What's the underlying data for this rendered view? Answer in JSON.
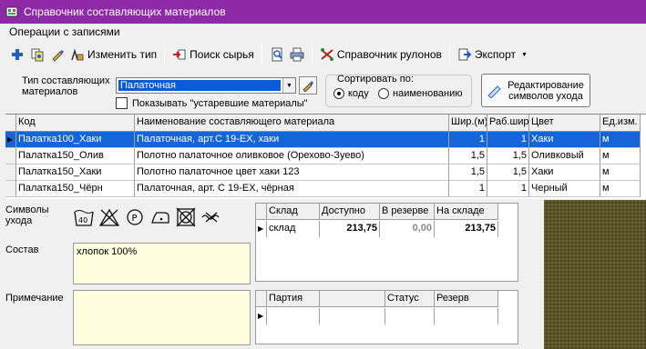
{
  "window": {
    "title": "Справочник составляющих материалов"
  },
  "menu": {
    "item": "Операции с записями"
  },
  "toolbar": {
    "change_type": "Изменить тип",
    "find_raw": "Поиск сырья",
    "rolls_ref": "Справочник рулонов",
    "export": "Экспорт"
  },
  "filter": {
    "type_label_1": "Тип составляющих",
    "type_label_2": "материалов",
    "type_value": "Палаточная",
    "show_outdated": "Показывать \"устаревшие материалы\"",
    "sort_label": "Сортировать по:",
    "sort_code": "коду",
    "sort_name": "наименованию",
    "edit_btn_1": "Редактирование",
    "edit_btn_2": "символов ухода"
  },
  "grid": {
    "headers": [
      "Код",
      "Наименование составляющего материала",
      "Шир.(м)",
      "Раб.шир",
      "Цвет",
      "Ед.изм."
    ],
    "rows": [
      [
        "Палатка100_Хаки",
        "Палаточная, арт.С 19-ЕХ, хаки",
        "1",
        "1",
        "Хаки",
        "м"
      ],
      [
        "Палатка150_Олив",
        "Полотно палаточное оливковое (Орехово-Зуево)",
        "1,5",
        "1,5",
        "Оливковый",
        "м"
      ],
      [
        "Палатка150_Хаки",
        "Полотно палаточное цвет хаки 123",
        "1,5",
        "1,5",
        "Хаки",
        "м"
      ],
      [
        "Палатка150_Чёрн",
        "Палаточная, арт. С 19-ЕХ, чёрная",
        "1",
        "1",
        "Черный",
        "м"
      ]
    ]
  },
  "details": {
    "care_label_1": "Символы",
    "care_label_2": "ухода",
    "composition_label": "Состав",
    "composition_value": "хлопок 100%",
    "note_label": "Примечание"
  },
  "stock": {
    "headers": [
      "Склад",
      "Доступно",
      "В резерве",
      "На складе"
    ],
    "row": [
      "склад",
      "213,75",
      "0,00",
      "213,75"
    ]
  },
  "batches": {
    "headers": [
      "Партия",
      "Статус",
      "Резерв"
    ]
  },
  "care_icons": [
    "wash-40-icon",
    "no-bleach-icon",
    "dryclean-p-icon",
    "iron-icon",
    "no-tumble-dry-icon",
    "no-wring-icon"
  ],
  "colors": {
    "title_bar": "#8e2aa8",
    "selection": "#1565d8",
    "yellow_panel": "#ffffe0"
  }
}
